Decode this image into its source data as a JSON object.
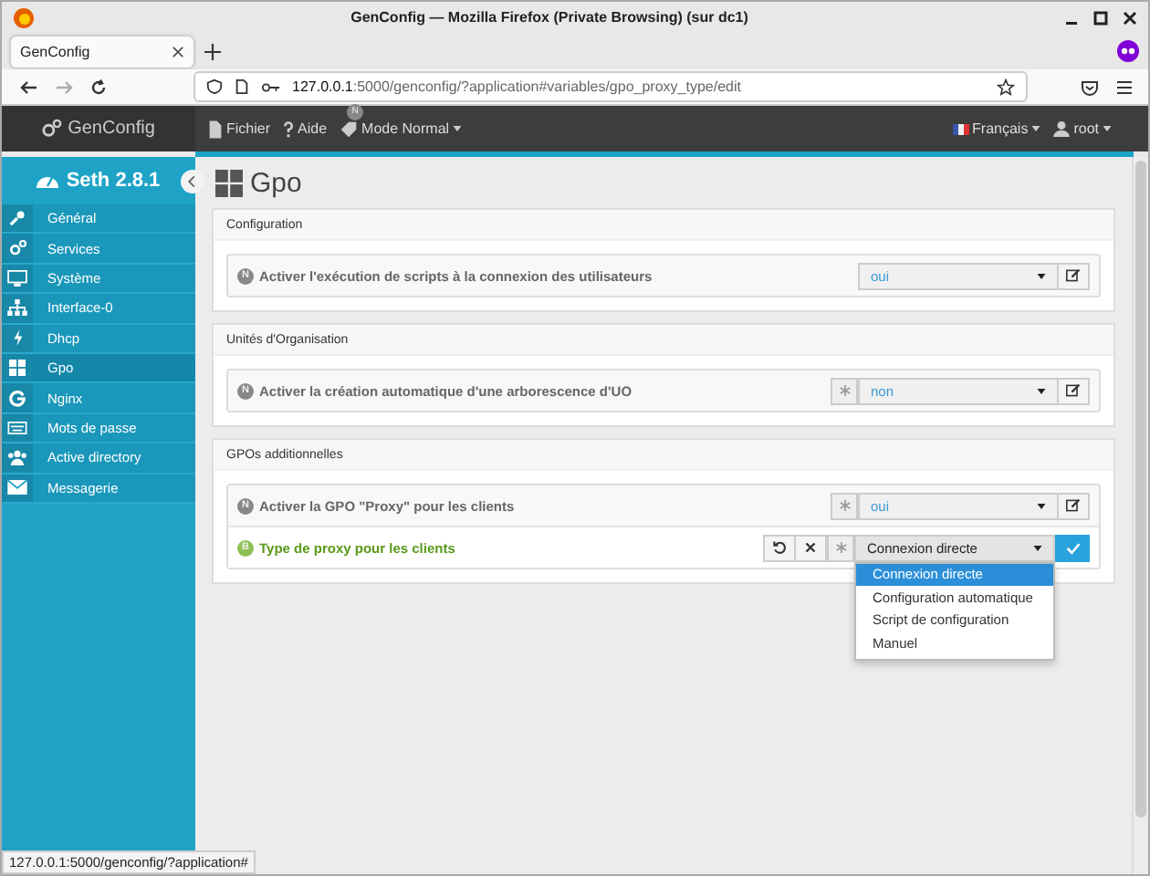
{
  "window": {
    "title": "GenConfig — Mozilla Firefox (Private Browsing) (sur dc1)"
  },
  "browser_tabs": [
    {
      "label": "GenConfig",
      "selected": true
    }
  ],
  "address_bar": {
    "host": "127.0.0.1",
    "rest": ":5000/genconfig/?application#variables/gpo_proxy_type/edit"
  },
  "app_bar": {
    "brand": "GenConfig",
    "menus": [
      {
        "label": "Fichier",
        "dropdown": false
      },
      {
        "label": "Aide",
        "dropdown": false
      },
      {
        "label": "Mode Normal",
        "dropdown": true,
        "badge": "N"
      }
    ],
    "language": "Français",
    "user": "root"
  },
  "sidebar": {
    "title": "Seth 2.8.1",
    "items": [
      {
        "label": "Général",
        "selected": false
      },
      {
        "label": "Services",
        "selected": false
      },
      {
        "label": "Système",
        "selected": false
      },
      {
        "label": "Interface-0",
        "selected": false
      },
      {
        "label": "Dhcp",
        "selected": false
      },
      {
        "label": "Gpo",
        "selected": true
      },
      {
        "label": "Nginx",
        "selected": false
      },
      {
        "label": "Mots de passe",
        "selected": false
      },
      {
        "label": "Active directory",
        "selected": false
      },
      {
        "label": "Messagerie",
        "selected": false
      }
    ]
  },
  "page_title": "Gpo",
  "panels": [
    {
      "title": "Configuration",
      "variables": [
        {
          "badge": "N",
          "label": "Activer l'exécution de scripts à la connexion des utilisateurs",
          "value": "oui",
          "modified_marker": false,
          "editing": false
        }
      ]
    },
    {
      "title": "Unités d'Organisation",
      "variables": [
        {
          "badge": "N",
          "label": "Activer la création automatique d'une arborescence d'UO",
          "value": "non",
          "modified_marker": true,
          "editing": false
        }
      ]
    },
    {
      "title": "GPOs additionnelles",
      "variables": [
        {
          "badge": "N",
          "label": "Activer la GPO \"Proxy\" pour les clients",
          "value": "oui",
          "modified_marker": true,
          "editing": false
        },
        {
          "badge": "B",
          "label": "Type de proxy pour les clients",
          "value": "Connexion directe",
          "modified_marker": true,
          "editing": true,
          "options": [
            {
              "label": "Connexion directe",
              "selected": true
            },
            {
              "label": "Configuration automatique",
              "selected": false
            },
            {
              "label": "Script de configuration",
              "selected": false
            },
            {
              "label": "Manuel",
              "selected": false
            }
          ]
        }
      ]
    }
  ],
  "status_link": "127.0.0.1:5000/genconfig/?application#"
}
